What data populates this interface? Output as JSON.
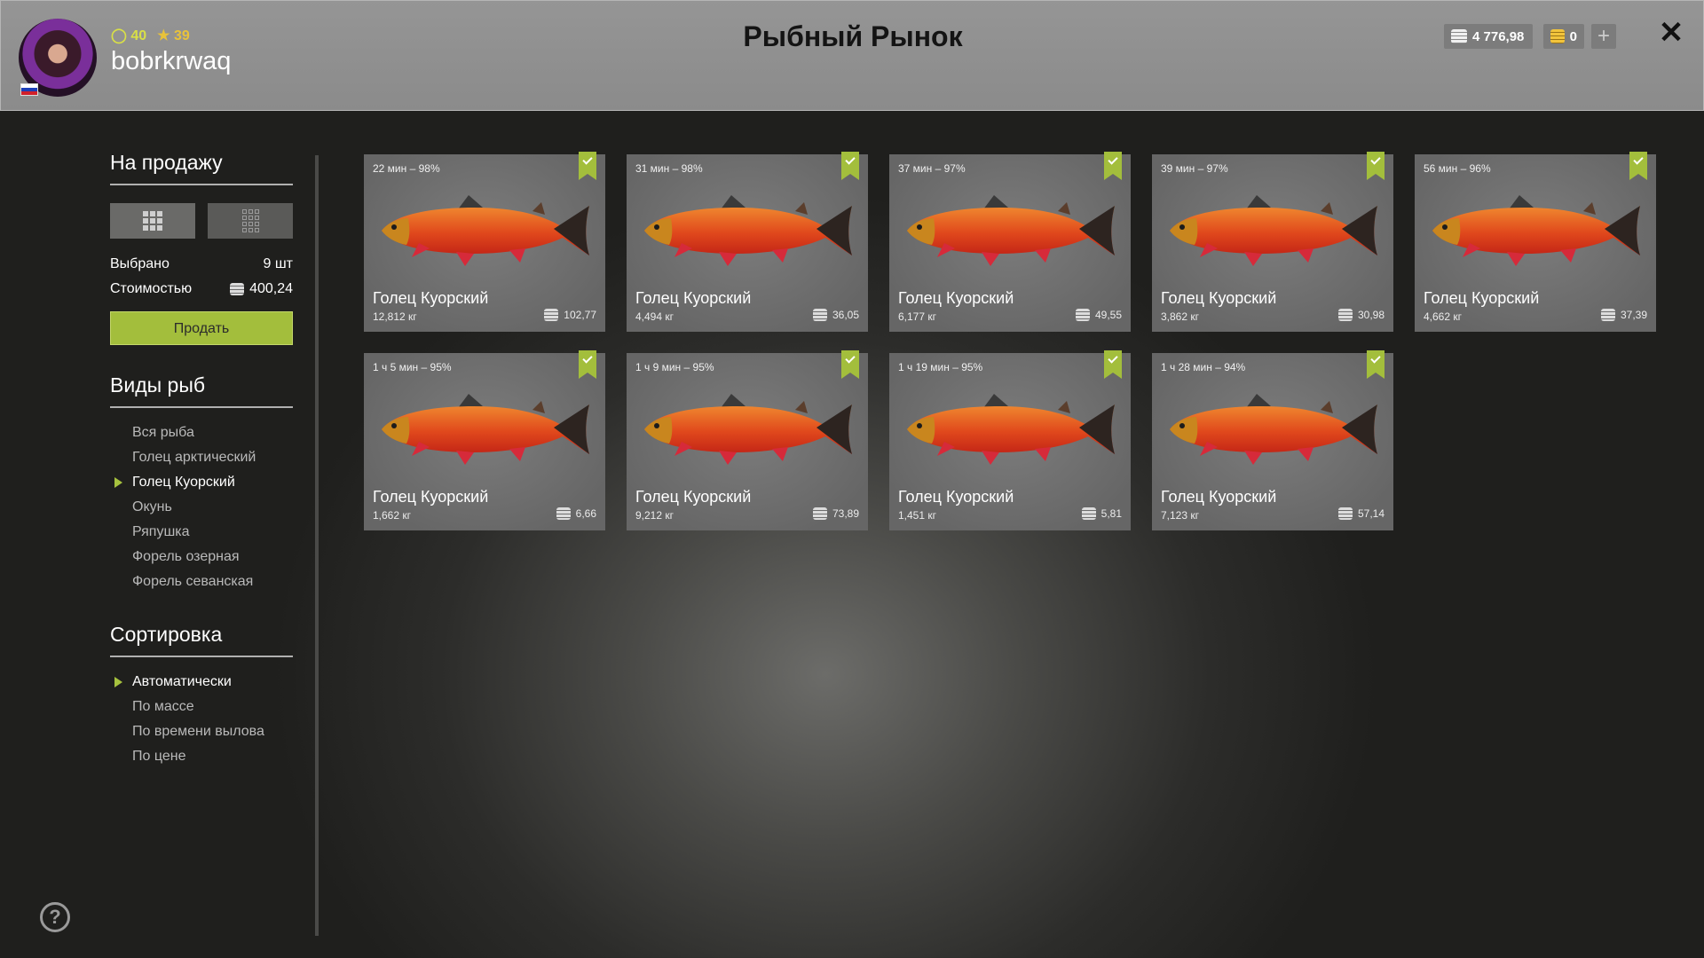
{
  "header": {
    "title": "Рыбный Рынок",
    "username": "bobrkrwaq",
    "level": "40",
    "rank": "39",
    "silver": "4 776,98",
    "gold": "0",
    "accent_color": "#a3be3c"
  },
  "sidebar": {
    "for_sale_title": "На продажу",
    "selected_label": "Выбрано",
    "selected_value": "9 шт",
    "cost_label": "Стоимостью",
    "cost_value": "400,24",
    "sell_label": "Продать",
    "species_title": "Виды рыб",
    "species": [
      {
        "label": "Вся рыба",
        "active": false
      },
      {
        "label": "Голец арктический",
        "active": false
      },
      {
        "label": "Голец Куорский",
        "active": true
      },
      {
        "label": "Окунь",
        "active": false
      },
      {
        "label": "Ряпушка",
        "active": false
      },
      {
        "label": "Форель озерная",
        "active": false
      },
      {
        "label": "Форель севанская",
        "active": false
      }
    ],
    "sort_title": "Сортировка",
    "sort": [
      {
        "label": "Автоматически",
        "active": true
      },
      {
        "label": "По массе",
        "active": false
      },
      {
        "label": "По времени вылова",
        "active": false
      },
      {
        "label": "По цене",
        "active": false
      }
    ]
  },
  "cards": [
    {
      "time": "22 мин – 98%",
      "name": "Голец Куорский",
      "weight": "12,812 кг",
      "price": "102,77"
    },
    {
      "time": "31 мин – 98%",
      "name": "Голец Куорский",
      "weight": "4,494 кг",
      "price": "36,05"
    },
    {
      "time": "37 мин – 97%",
      "name": "Голец Куорский",
      "weight": "6,177 кг",
      "price": "49,55"
    },
    {
      "time": "39 мин – 97%",
      "name": "Голец Куорский",
      "weight": "3,862 кг",
      "price": "30,98"
    },
    {
      "time": "56 мин – 96%",
      "name": "Голец Куорский",
      "weight": "4,662 кг",
      "price": "37,39"
    },
    {
      "time": "1 ч 5 мин – 95%",
      "name": "Голец Куорский",
      "weight": "1,662 кг",
      "price": "6,66"
    },
    {
      "time": "1 ч 9 мин – 95%",
      "name": "Голец Куорский",
      "weight": "9,212 кг",
      "price": "73,89"
    },
    {
      "time": "1 ч 19 мин – 95%",
      "name": "Голец Куорский",
      "weight": "1,451 кг",
      "price": "5,81"
    },
    {
      "time": "1 ч 28 мин – 94%",
      "name": "Голец Куорский",
      "weight": "7,123 кг",
      "price": "57,14"
    }
  ]
}
